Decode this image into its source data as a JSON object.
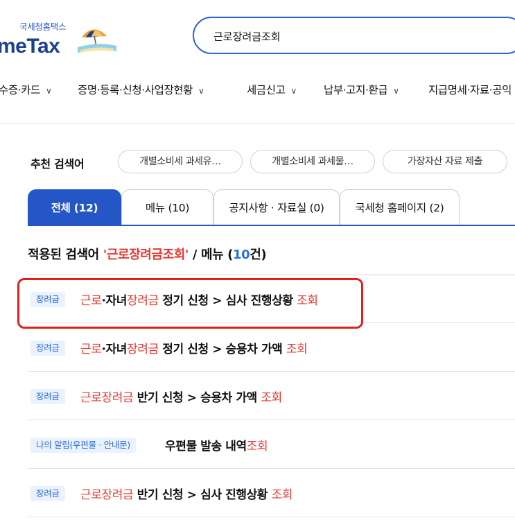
{
  "header": {
    "logo_sub": "국세청홈택스",
    "logo_main": "meTax",
    "search_value": "근로장려금조회"
  },
  "gnb": [
    {
      "label": "수증·카드"
    },
    {
      "label": "증명·등록·신청·사업장현황"
    },
    {
      "label": "세금신고"
    },
    {
      "label": "납부·고지·환급"
    },
    {
      "label": "지급명세·자료·공익"
    }
  ],
  "recommended": {
    "label": "추천 검색어",
    "chips": [
      "개별소비세 과세유…",
      "개별소비세 과세물…",
      "가장자산 자료 제출"
    ]
  },
  "tabs": [
    {
      "label": "전체 (12)",
      "active": true
    },
    {
      "label": "메뉴 (10)",
      "active": false
    },
    {
      "label": "공지사항 · 자료실 (0)",
      "active": false
    },
    {
      "label": "국세청 홈페이지 (2)",
      "active": false
    }
  ],
  "result_heading": {
    "prefix": "적용된 검색어 ",
    "keyword": "'근로장려금조회'",
    "middle": " / 메뉴 (",
    "count": "10",
    "suffix": "건)"
  },
  "results": [
    {
      "badge": "장려금",
      "parts": [
        [
          "근로",
          true
        ],
        [
          "·자녀",
          false
        ],
        [
          "장려금",
          true
        ],
        [
          " 정기 신청 > 심사 진행상황 ",
          false
        ],
        [
          "조회",
          true
        ]
      ]
    },
    {
      "badge": "장려금",
      "parts": [
        [
          "근로",
          true
        ],
        [
          "·자녀",
          false
        ],
        [
          "장려금",
          true
        ],
        [
          " 정기 신청 > 승용차 가액 ",
          false
        ],
        [
          "조회",
          true
        ]
      ]
    },
    {
      "badge": "장려금",
      "parts": [
        [
          "근로장려금",
          true
        ],
        [
          " 반기 신청 > 승용차 가액 ",
          false
        ],
        [
          "조회",
          true
        ]
      ]
    },
    {
      "badge": "나의 알림(우편물 · 안내문)",
      "parts": [
        [
          "우편물 발송 내역",
          false
        ],
        [
          "조회",
          true
        ]
      ]
    },
    {
      "badge": "장려금",
      "parts": [
        [
          "근로장려금",
          true
        ],
        [
          " 반기 신청 > 심사 진행상황 ",
          false
        ],
        [
          "조회",
          true
        ]
      ]
    }
  ],
  "colors": {
    "accent": "#2457c5",
    "highlight": "#e8362e",
    "annotation_box": "#e0201a"
  }
}
